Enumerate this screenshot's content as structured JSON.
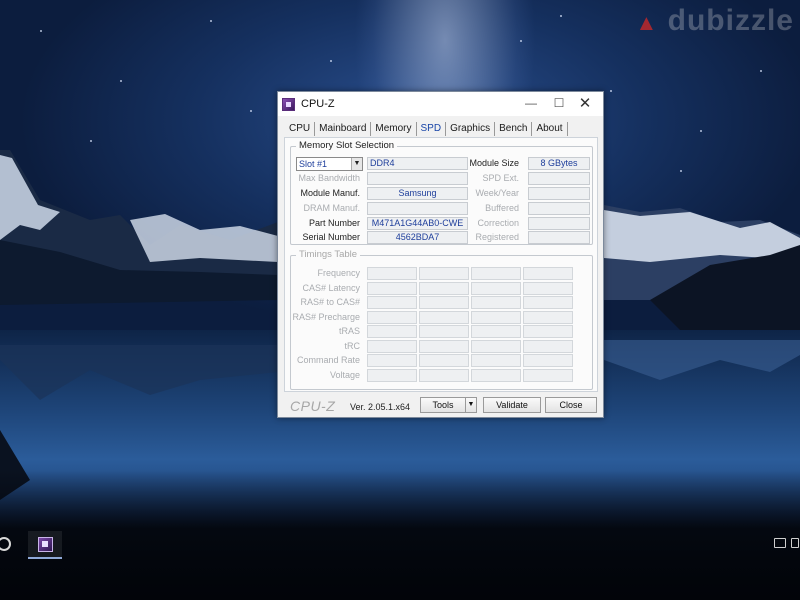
{
  "watermark": "dubizzle",
  "window": {
    "title": "CPU-Z",
    "controls": {
      "minimize": "—",
      "maximize": "☐",
      "close": "✕"
    }
  },
  "tabs": [
    {
      "label": "CPU",
      "active": false
    },
    {
      "label": "Mainboard",
      "active": false
    },
    {
      "label": "Memory",
      "active": false
    },
    {
      "label": "SPD",
      "active": true
    },
    {
      "label": "Graphics",
      "active": false
    },
    {
      "label": "Bench",
      "active": false
    },
    {
      "label": "About",
      "active": false
    }
  ],
  "slot_selection": {
    "title": "Memory Slot Selection",
    "selected_slot": "Slot #1",
    "memory_type": "DDR4",
    "labels": {
      "max_bandwidth": "Max Bandwidth",
      "module_manuf": "Module Manuf.",
      "dram_manuf": "DRAM Manuf.",
      "part_number": "Part Number",
      "serial_number": "Serial Number",
      "module_size": "Module Size",
      "spd_ext": "SPD Ext.",
      "week_year": "Week/Year",
      "buffered": "Buffered",
      "correction": "Correction",
      "registered": "Registered"
    },
    "values": {
      "max_bandwidth": "",
      "module_manuf": "Samsung",
      "dram_manuf": "",
      "part_number": "M471A1G44AB0-CWE",
      "serial_number": "4562BDA7",
      "module_size": "8 GBytes",
      "spd_ext": "",
      "week_year": "",
      "buffered": "",
      "correction": "",
      "registered": ""
    }
  },
  "timings_table": {
    "title": "Timings Table",
    "rows": [
      "Frequency",
      "CAS# Latency",
      "RAS# to CAS#",
      "RAS# Precharge",
      "tRAS",
      "tRC",
      "Command Rate",
      "Voltage"
    ]
  },
  "bottom": {
    "brand": "CPU-Z",
    "version": "Ver. 2.05.1.x64",
    "tools": "Tools",
    "tools_arrow": "▼",
    "validate": "Validate",
    "close": "Close"
  }
}
